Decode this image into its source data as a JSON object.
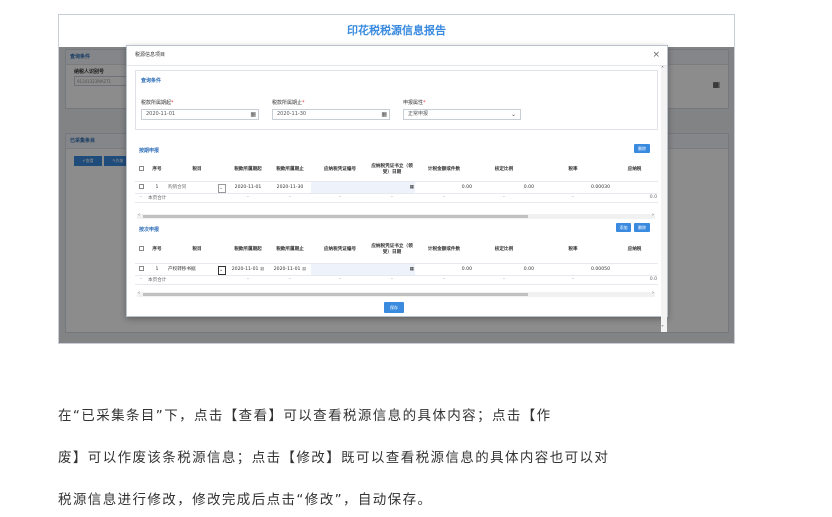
{
  "page": {
    "title": "印花税税源信息报告",
    "bg_section_query": "查询条件",
    "bg_taxpayer_label": "纳税人识别号",
    "bg_taxpayer_value": "91341323MA2T1",
    "bg_section_collected": "已采集条目",
    "bg_btn_view": "查看",
    "bg_btn_void": "作废"
  },
  "modal": {
    "title": "税源信息项目",
    "close": "×",
    "query_section": "查询条件",
    "period_start_label": "税款所属期起",
    "period_start_value": "2020-11-01",
    "period_end_label": "税款所属期止",
    "period_end_value": "2020-11-30",
    "report_type_label": "申报属性",
    "report_type_value": "正常申报",
    "required_mark": "*",
    "section_by_period": "按期申报",
    "section_by_count": "按次申报",
    "btn_delete": "删除",
    "btn_add": "添加",
    "btn_delete2": "删除",
    "btn_save": "保存"
  },
  "table_headers": [
    "",
    "序号",
    "税目",
    "税款所属期起",
    "税款所属期止",
    "应纳税凭证编号",
    "应纳税凭证书立（领受）日期",
    "计税金额或件数",
    "核定比例",
    "税率",
    "应纳税"
  ],
  "table1": {
    "row": {
      "index": "1",
      "item": "购销合同",
      "start": "2020-11-01",
      "end": "2020-11-30",
      "amount": "0.00",
      "ratio": "0.00",
      "rate": "0.00030"
    },
    "subtotal_label": "本页合计",
    "dash": "-",
    "last_col": "0.0"
  },
  "table2": {
    "row": {
      "index": "1",
      "item": "产权转移书据",
      "start": "2020-11-01",
      "end": "2020-11-01",
      "amount": "0.00",
      "ratio": "0.00",
      "rate": "0.00050"
    },
    "subtotal_label": "本页合计",
    "dash": "-",
    "last_col": "0.0"
  },
  "paragraph": {
    "line1": "在“已采集条目”下，点击【查看】可以查看税源信息的具体内容；点击【作",
    "line2": "废】可以作废该条税源信息；点击【修改】既可以查看税源信息的具体内容也可以对",
    "line3": "税源信息进行修改，修改完成后点击“修改”，自动保存。"
  },
  "colors": {
    "accent": "#3a8be0",
    "required": "#ee3333"
  },
  "icons": [
    "calendar-icon",
    "chevron-down-icon",
    "close-icon",
    "checkbox-icon"
  ]
}
